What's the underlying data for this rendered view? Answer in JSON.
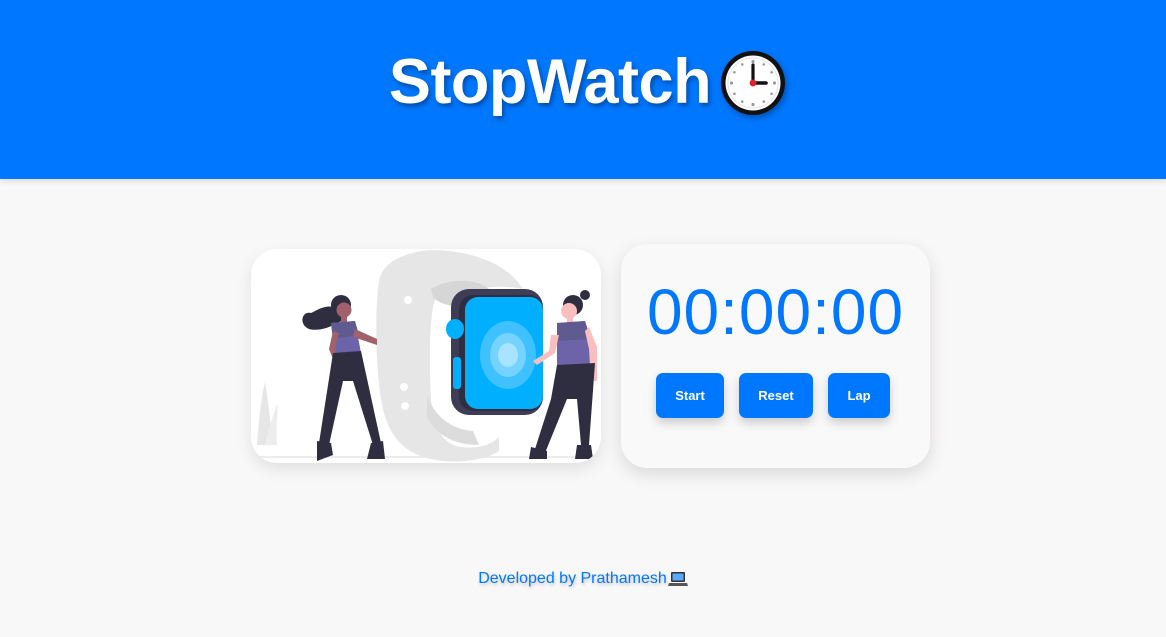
{
  "header": {
    "title": "StopWatch",
    "title_icon": "clock-icon",
    "background_color": "#0077ff"
  },
  "illustration": {
    "subject": "two-people-with-smartwatch-illustration",
    "accent_color": "#00b0ff"
  },
  "timer": {
    "display": "00:00:00",
    "color": "#0077ff"
  },
  "controls": {
    "start_label": "Start",
    "reset_label": "Reset",
    "lap_label": "Lap"
  },
  "footer": {
    "text": "Developed by Prathamesh",
    "icon": "laptop-icon"
  }
}
